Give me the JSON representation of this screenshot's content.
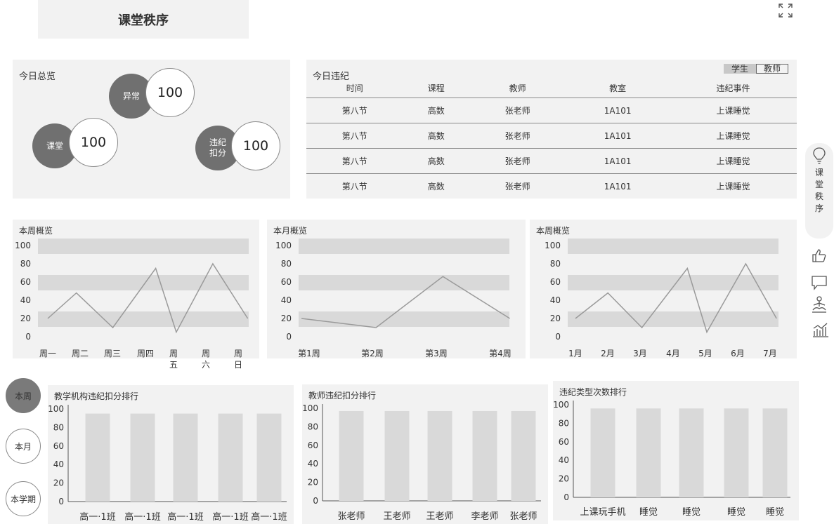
{
  "header": {
    "title": "课堂秩序"
  },
  "overview": {
    "title": "今日总览",
    "items": [
      {
        "label": "异常",
        "value": "100"
      },
      {
        "label": "课堂",
        "value": "100"
      },
      {
        "label": "违纪扣分",
        "value": "100"
      }
    ]
  },
  "violations": {
    "title": "今日违纪",
    "toggle": {
      "student": "学生",
      "teacher": "教师"
    },
    "columns": [
      "时间",
      "课程",
      "教师",
      "教室",
      "违纪事件"
    ],
    "rows": [
      [
        "第八节",
        "高数",
        "张老师",
        "1A101",
        "上课睡觉"
      ],
      [
        "第八节",
        "高数",
        "张老师",
        "1A101",
        "上课睡觉"
      ],
      [
        "第八节",
        "高数",
        "张老师",
        "1A101",
        "上课睡觉"
      ],
      [
        "第八节",
        "高数",
        "张老师",
        "1A101",
        "上课睡觉"
      ]
    ]
  },
  "sidebar": {
    "label": "课堂秩序"
  },
  "periods": [
    "本周",
    "本月",
    "本学期"
  ],
  "chart_data": [
    {
      "type": "line",
      "title": "本周概览",
      "categories": [
        "周一",
        "周二",
        "周三",
        "周四",
        "周五",
        "周六",
        "周日"
      ],
      "tick_labels": [
        "周一",
        "周二",
        "周三",
        "周四",
        "周\n五",
        "周\n六",
        "周\n日"
      ],
      "points": [
        [
          0,
          20
        ],
        [
          0.9,
          48
        ],
        [
          2.05,
          10
        ],
        [
          3.4,
          75
        ],
        [
          4.05,
          5
        ],
        [
          5.2,
          80
        ],
        [
          6.3,
          20
        ]
      ],
      "yticks": [
        0,
        20,
        40,
        60,
        80,
        100
      ],
      "ylim": [
        0,
        100
      ]
    },
    {
      "type": "line",
      "title": "本月概览",
      "categories": [
        "第1周",
        "第2周",
        "第3周",
        "第4周"
      ],
      "tick_labels": [
        "第1周",
        "第2周",
        "第3周",
        "第4周"
      ],
      "points": [
        [
          -0.12,
          20
        ],
        [
          1.05,
          10
        ],
        [
          2.1,
          66
        ],
        [
          3.15,
          20
        ]
      ],
      "yticks": [
        0,
        20,
        40,
        60,
        80,
        100
      ],
      "ylim": [
        0,
        100
      ]
    },
    {
      "type": "line",
      "title": "本周概览",
      "categories": [
        "1月",
        "2月",
        "3月",
        "4月",
        "5月",
        "6月",
        "7月"
      ],
      "tick_labels": [
        "1月",
        "2月",
        "3月",
        "4月",
        "5月",
        "6月",
        "7月"
      ],
      "points": [
        [
          0,
          20
        ],
        [
          1,
          48
        ],
        [
          2.05,
          10
        ],
        [
          3.45,
          75
        ],
        [
          4.05,
          5
        ],
        [
          5.25,
          80
        ],
        [
          6.2,
          20
        ]
      ],
      "yticks": [
        0,
        20,
        40,
        60,
        80,
        100
      ],
      "ylim": [
        0,
        100
      ]
    },
    {
      "type": "bar",
      "title": "教学机构违纪扣分排行",
      "categories": [
        "高一·1班",
        "高一·1班",
        "高一·1班",
        "高一·1班",
        "高一·1班"
      ],
      "values": [
        95,
        95,
        95,
        95,
        95
      ],
      "yticks": [
        0,
        20,
        40,
        60,
        80,
        100
      ],
      "ylim": [
        0,
        100
      ]
    },
    {
      "type": "bar",
      "title": "教师违纪扣分排行",
      "categories": [
        "张老师",
        "王老师",
        "王老师",
        "李老师",
        "张老师"
      ],
      "values": [
        97,
        97,
        97,
        97,
        97
      ],
      "yticks": [
        0,
        20,
        40,
        60,
        80,
        100
      ],
      "ylim": [
        0,
        100
      ]
    },
    {
      "type": "bar",
      "title": "违纪类型次数排行",
      "categories": [
        "上课玩手机",
        "睡觉",
        "睡觉",
        "睡觉",
        "睡觉"
      ],
      "values": [
        96,
        96,
        96,
        96,
        96
      ],
      "yticks": [
        0,
        20,
        40,
        60,
        80,
        100
      ],
      "ylim": [
        0,
        100
      ]
    }
  ]
}
